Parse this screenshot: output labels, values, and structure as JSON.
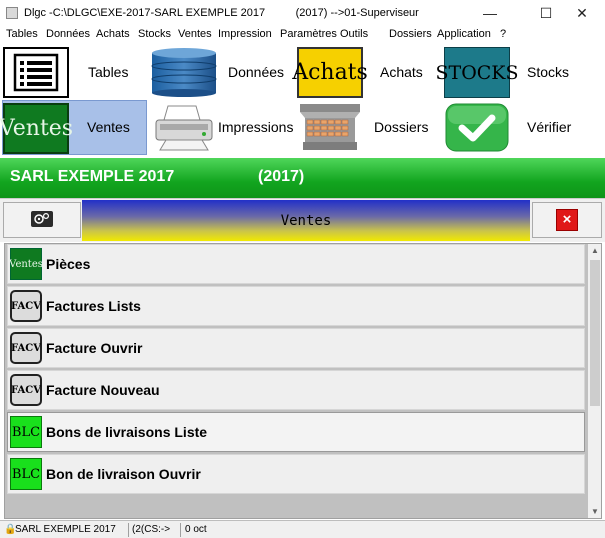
{
  "window": {
    "title": "Dlgc -C:\\DLGC\\EXE-2017-SARL EXEMPLE 2017          (2017) -->01-Superviseur",
    "minimize": "—",
    "maximize": "☐",
    "close": "✕"
  },
  "menu": [
    "Tables",
    "Données",
    "Achats",
    "Stocks",
    "Ventes",
    "Impression",
    "Paramètres",
    "Outils",
    "Dossiers",
    "Application",
    "?"
  ],
  "toolbar": {
    "tables": "Tables",
    "donnees": "Données",
    "achats": "Achats",
    "achats_icon_text": "Achats",
    "stocks": "Stocks",
    "stocks_icon_text": "STOCKS",
    "ventes": "Ventes",
    "ventes_icon_text": "Ventes",
    "impressions": "Impressions",
    "dossiers": "Dossiers",
    "verifier": "Vérifier"
  },
  "company_band": {
    "company": "SARL EXEMPLE 2017",
    "year": "(2017)"
  },
  "panel": {
    "title": "Ventes",
    "close_symbol": "×"
  },
  "list": {
    "items": [
      {
        "label": "Pièces",
        "icon_text": "Ventes",
        "icon": "ventes-icon"
      },
      {
        "label": "Factures Lists",
        "icon_text": "FACV",
        "icon": "facv-icon"
      },
      {
        "label": "Facture Ouvrir",
        "icon_text": "FACV",
        "icon": "facv-icon"
      },
      {
        "label": "Facture Nouveau",
        "icon_text": "FACV",
        "icon": "facv-icon"
      },
      {
        "label": "Bons de livraisons Liste",
        "icon_text": "BLC",
        "icon": "blc-icon"
      },
      {
        "label": "Bon de livraison Ouvrir",
        "icon_text": "BLC",
        "icon": "blc-icon"
      }
    ]
  },
  "status": {
    "company": "SARL EXEMPLE 2017",
    "year_path": "(2(CS:->",
    "size": "0 oct"
  }
}
